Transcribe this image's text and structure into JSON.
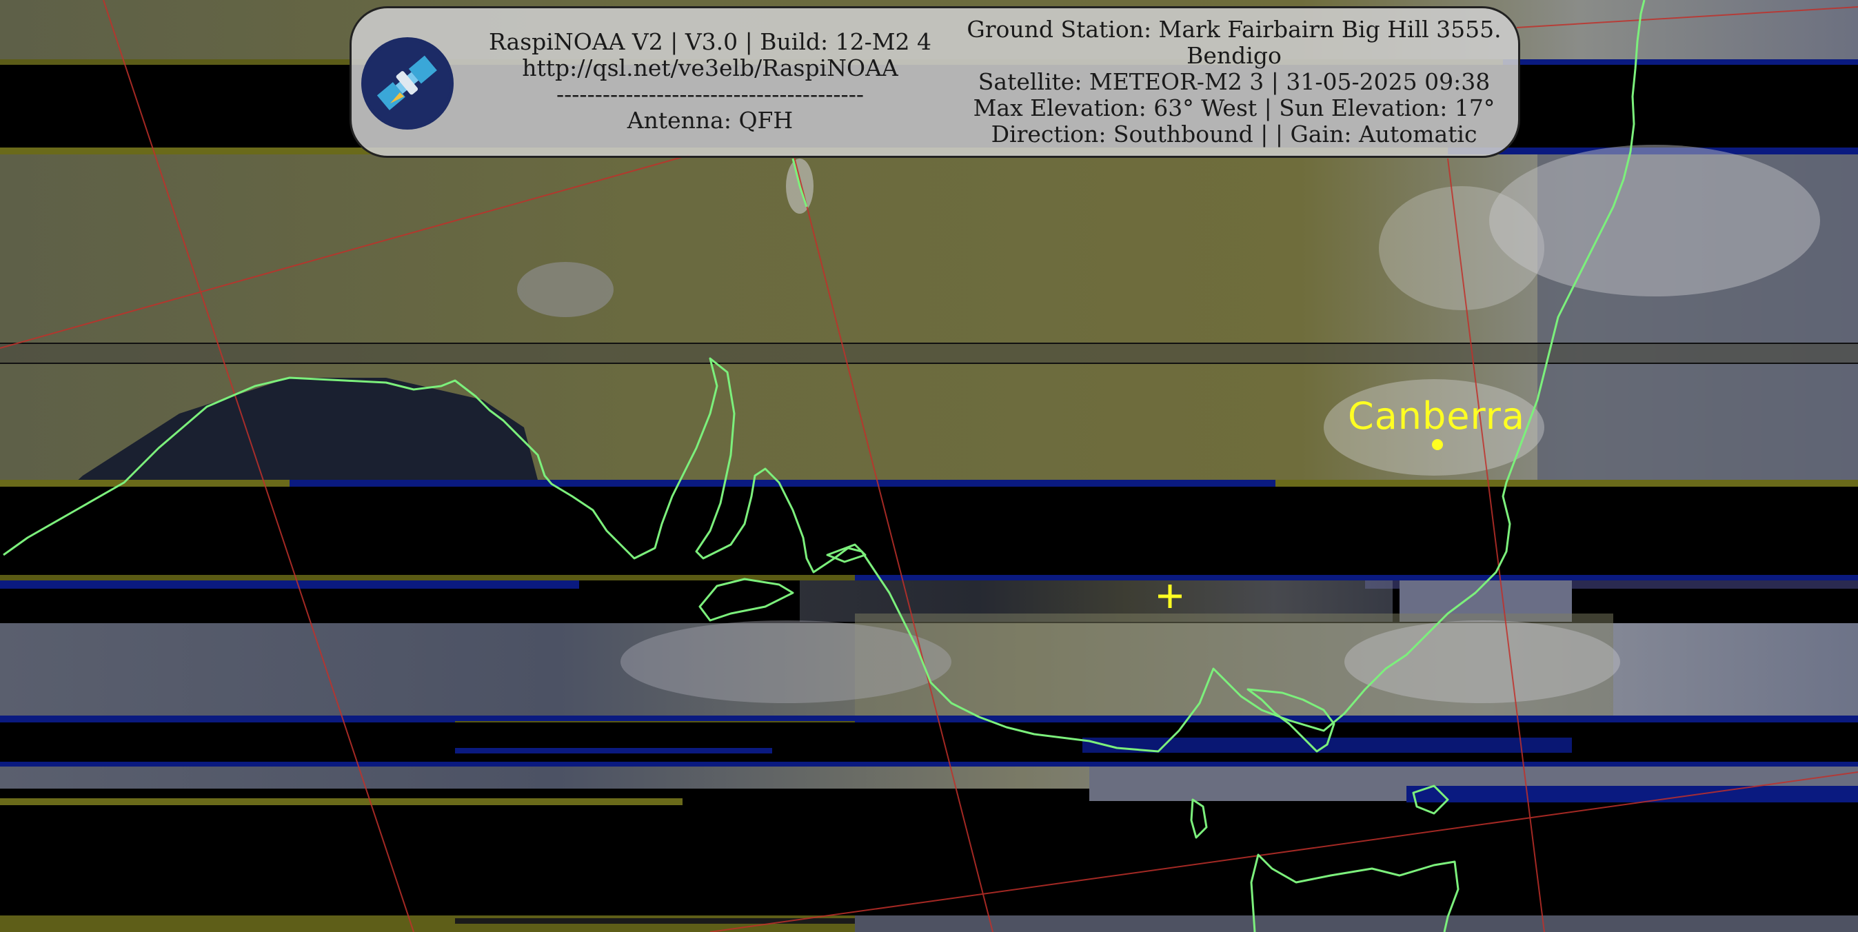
{
  "header": {
    "left_lines": [
      "RaspiNOAA V2 | V3.0 | Build: 12-M2 4",
      "http://qsl.net/ve3elb/RaspiNOAA",
      "----------------------------------------",
      "Antenna: QFH"
    ],
    "right_lines": [
      "Ground Station: Mark Fairbairn Big Hill 3555.",
      "Bendigo",
      "Satellite: METEOR-M2 3 | 31-05-2025 09:38",
      "Max Elevation: 63° West | Sun Elevation: 17°",
      "Direction: Southbound | | Gain: Automatic"
    ]
  },
  "map": {
    "city_label": "Canberra",
    "colors": {
      "coastline": "#7cf07c",
      "graticule": "#c0302a",
      "label": "#ffff22",
      "band_blue": "#0a1a80",
      "band_yellow": "#8a8a10"
    }
  }
}
